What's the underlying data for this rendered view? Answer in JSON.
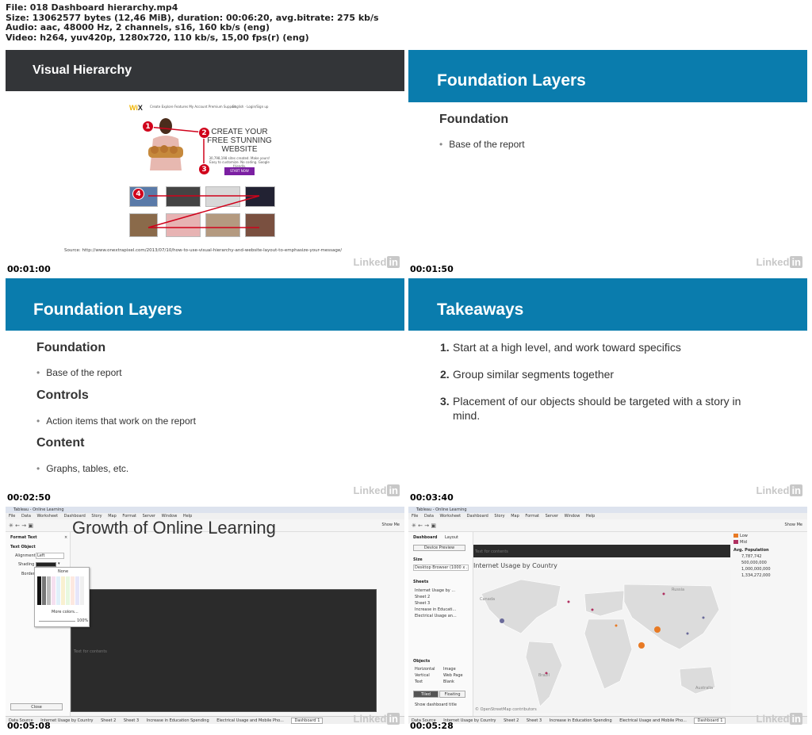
{
  "header": {
    "line1": "File: 018 Dashboard hierarchy.mp4",
    "line2": "Size: 13062577 bytes (12,46 MiB), duration: 00:06:20, avg.bitrate: 275 kb/s",
    "line3": "Audio: aac, 48000 Hz, 2 channels, s16, 160 kb/s (eng)",
    "line4": "Video: h264, yuv420p, 1280x720, 110 kb/s, 15,00 fps(r) (eng)"
  },
  "watermark": {
    "brand": "Linked",
    "in": "in"
  },
  "colors": {
    "band_blue": "#0a7cad",
    "band_dark": "#333538",
    "marker_red": "#d0021b",
    "wix_purple": "#7b1fa2"
  },
  "thumb1": {
    "timestamp": "00:01:00",
    "title": "Visual Hierarchy",
    "wix": {
      "logo_wi": "Wi",
      "logo_x": "X",
      "nav": "Create   Explore   Features   My Account   Premium   Support",
      "nav_right": "English   ·   Login/Sign up",
      "headline": [
        "CREATE YOUR",
        "FREE STUNNING",
        "WEBSITE"
      ],
      "sub": [
        "30,798,198 sites created. Make yours!",
        "Easy to customize. No coding. Google friendly."
      ],
      "button": "START NOW",
      "markers": [
        "1",
        "2",
        "3",
        "4"
      ]
    },
    "source": "Source: http://www.onextrapixel.com/2013/07/10/how-to-use-visual-hierarchy-and-website-layout-to-emphasize-your-message/"
  },
  "thumb2": {
    "timestamp": "00:01:50",
    "title": "Foundation Layers",
    "section": "Foundation",
    "bullet": "Base of the report"
  },
  "thumb3": {
    "timestamp": "00:02:50",
    "title": "Foundation Layers",
    "sections": [
      {
        "heading": "Foundation",
        "bullet": "Base of the report"
      },
      {
        "heading": "Controls",
        "bullet": "Action items that work on the report"
      },
      {
        "heading": "Content",
        "bullet": "Graphs, tables, etc."
      }
    ]
  },
  "thumb4": {
    "timestamp": "00:03:40",
    "title": "Takeaways",
    "items": [
      {
        "num": "1.",
        "text": "Start at a high level, and work toward specifics"
      },
      {
        "num": "2.",
        "text": "Group similar segments together"
      },
      {
        "num": "3.",
        "text": "Placement of our objects should be targeted with a story in mind."
      }
    ]
  },
  "thumb5": {
    "timestamp": "00:05:08",
    "window_title": "Tableau - Online Learning",
    "menu": [
      "File",
      "Data",
      "Worksheet",
      "Dashboard",
      "Story",
      "Map",
      "Format",
      "Server",
      "Window",
      "Help"
    ],
    "show_me": "Show Me",
    "canvas_title": "Growth of Online Learning",
    "format_text": "Format Text",
    "text_object": "Text Object",
    "alignment_label": "Alignment",
    "alignment_value": "Left",
    "shading_label": "Shading",
    "border_label": "Border",
    "none_label": "None",
    "more_colors": "More colors...",
    "opacity": "100%",
    "close_button": "Close",
    "placeholder": "Text for contents",
    "tabs": [
      "Data Source",
      "Internet Usage by Country",
      "Sheet 2",
      "Sheet 3",
      "Increase in Education Spending",
      "Electrical Usage and Mobile Pho...",
      "Dashboard 1"
    ]
  },
  "thumb6": {
    "timestamp": "00:05:28",
    "window_title": "Tableau - Online Learning",
    "menu": [
      "File",
      "Data",
      "Worksheet",
      "Dashboard",
      "Story",
      "Map",
      "Format",
      "Server",
      "Window",
      "Help"
    ],
    "show_me": "Show Me",
    "side_tabs": [
      "Dashboard",
      "Layout"
    ],
    "device_preview": "Device Preview",
    "size_label": "Size",
    "size_value": "Desktop Browser (1000 x ...",
    "sheets_label": "Sheets",
    "sheets": [
      "Internet Usage by ...",
      "Sheet 2",
      "Sheet 3",
      "Increase in Educati...",
      "Electrical Usage an..."
    ],
    "objects_label": "Objects",
    "objects": [
      "Horizontal",
      "Image",
      "Vertical",
      "Web Page",
      "Text",
      "Blank"
    ],
    "tiled": "Tiled",
    "floating": "Floating",
    "show_title": "Show dashboard title",
    "dark_bar_text": "Text for contents",
    "map_title": "Internet Usage by Country",
    "legend_low": "Low",
    "legend_mid": "Mid",
    "avg_pop": "Avg. Population",
    "pop_values": [
      "7,787,742",
      "500,000,000",
      "1,000,000,000",
      "1,334,272,000"
    ],
    "map_labels": [
      "Canada",
      "Russia",
      "Brazil",
      "Australia"
    ],
    "osm_credit": "© OpenStreetMap contributors",
    "tabs": [
      "Data Source",
      "Internet Usage by Country",
      "Sheet 2",
      "Sheet 3",
      "Increase in Education Spending",
      "Electrical Usage and Mobile Pho...",
      "Dashboard 1"
    ]
  }
}
